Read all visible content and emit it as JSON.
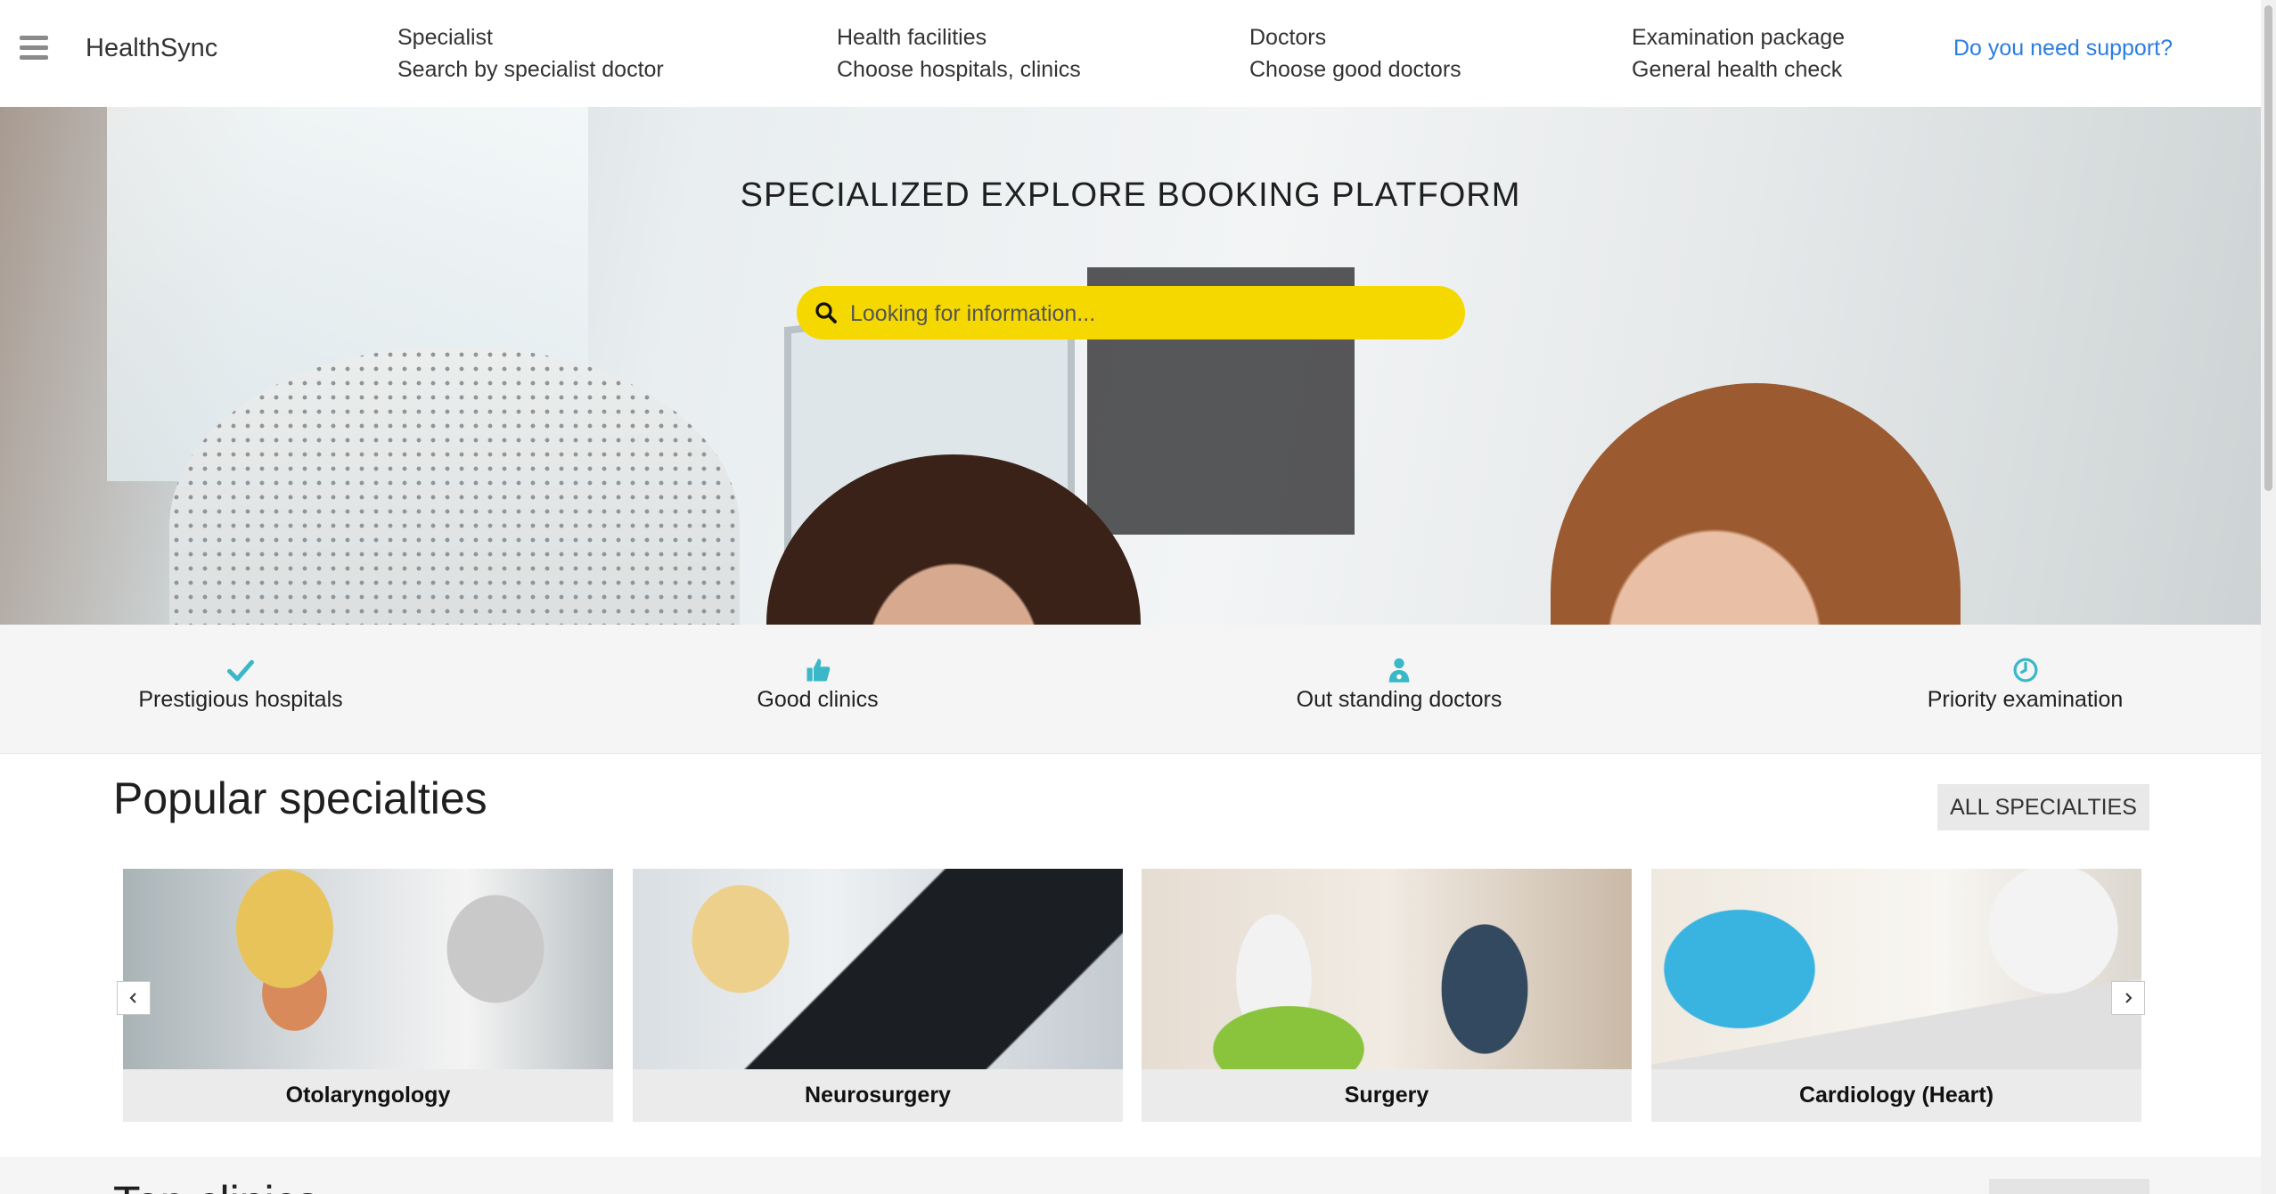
{
  "header": {
    "brand": "HealthSync",
    "nav": [
      {
        "title": "Specialist",
        "subtitle": "Search by specialist doctor"
      },
      {
        "title": "Health facilities",
        "subtitle": "Choose hospitals, clinics"
      },
      {
        "title": "Doctors",
        "subtitle": "Choose good doctors"
      },
      {
        "title": "Examination package",
        "subtitle": "General health check"
      }
    ],
    "support_link": "Do you need support?"
  },
  "hero": {
    "title": "SPECIALIZED EXPLORE BOOKING PLATFORM",
    "search_placeholder": "Looking for information...",
    "search_icon": "search-icon"
  },
  "features": [
    {
      "icon": "check-icon",
      "label": "Prestigious hospitals"
    },
    {
      "icon": "thumbs-up-icon",
      "label": "Good clinics"
    },
    {
      "icon": "doctor-icon",
      "label": "Out standing doctors"
    },
    {
      "icon": "clock-icon",
      "label": "Priority examination"
    }
  ],
  "popular": {
    "title": "Popular specialties",
    "all_button": "ALL SPECIALTIES",
    "cards": [
      {
        "name": "Otolaryngology"
      },
      {
        "name": "Neurosurgery"
      },
      {
        "name": "Surgery"
      },
      {
        "name": "Cardiology (Heart)"
      }
    ],
    "prev_icon": "chevron-left-icon",
    "next_icon": "chevron-right-icon"
  },
  "next_section": {
    "title": "Top clinics"
  },
  "colors": {
    "accent_yellow": "#f5d800",
    "link_blue": "#2b7de0",
    "feature_icon_teal": "#3bb8c8"
  }
}
